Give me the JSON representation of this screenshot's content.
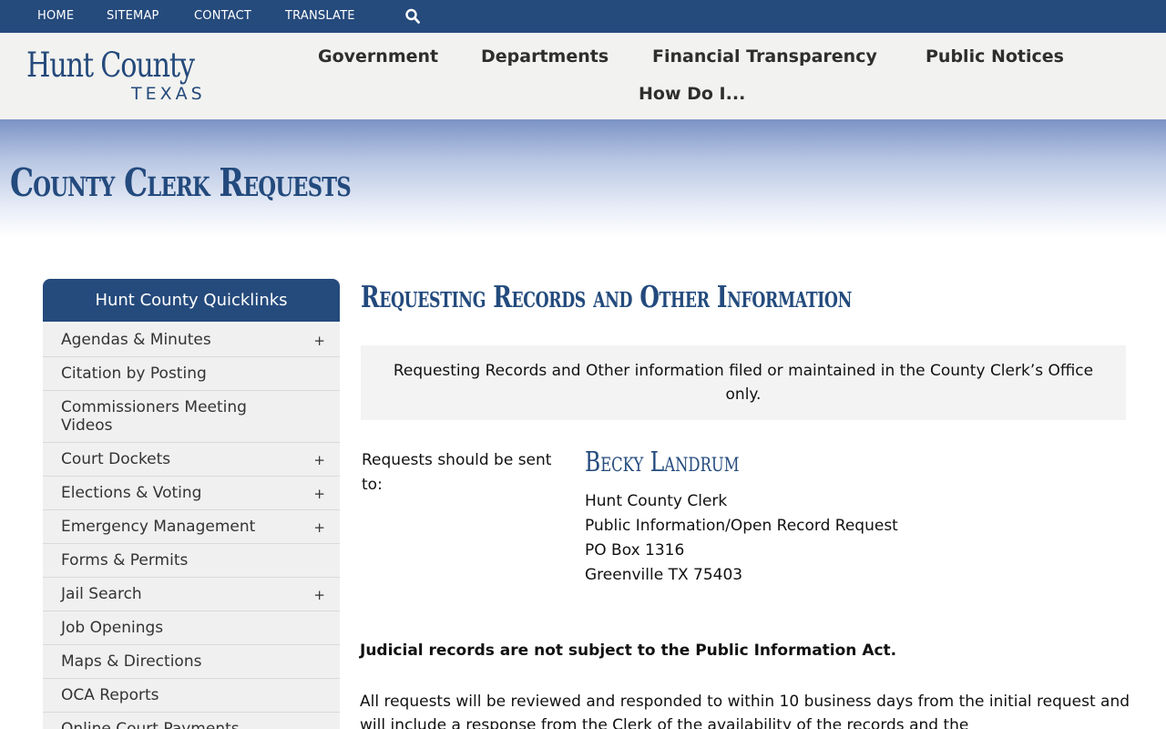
{
  "topbar": {
    "links": [
      "HOME",
      "SITEMAP",
      "CONTACT",
      "TRANSLATE"
    ],
    "search_icon": "search-icon"
  },
  "logo": {
    "line1": "Hunt County",
    "line2": "TEXAS"
  },
  "mainnav": [
    "Government",
    "Departments",
    "Financial Transparency",
    "Public Notices",
    "How Do I..."
  ],
  "banner": {
    "title": "County Clerk Requests"
  },
  "sidebar": {
    "title": "Hunt County Quicklinks",
    "items": [
      {
        "label": "Agendas & Minutes",
        "expand": "+"
      },
      {
        "label": "Citation by Posting",
        "expand": ""
      },
      {
        "label": "Commissioners Meeting Videos",
        "expand": ""
      },
      {
        "label": "Court Dockets",
        "expand": "+"
      },
      {
        "label": "Elections & Voting",
        "expand": "+"
      },
      {
        "label": "Emergency Management",
        "expand": "+"
      },
      {
        "label": "Forms & Permits",
        "expand": ""
      },
      {
        "label": "Jail Search",
        "expand": "+"
      },
      {
        "label": "Job Openings",
        "expand": ""
      },
      {
        "label": "Maps & Directions",
        "expand": ""
      },
      {
        "label": "OCA Reports",
        "expand": ""
      },
      {
        "label": "Online Court Payments",
        "expand": ""
      }
    ]
  },
  "content": {
    "heading": "Requesting Records and Other Information",
    "notice": "Requesting Records and Other information filed or maintained in the County Clerk’s Office only.",
    "requests_label": "Requests should be sent to:",
    "clerk_name": "Becky Landrum",
    "address": [
      "Hunt County Clerk",
      "Public Information/Open Record Request",
      "PO Box 1316",
      "Greenville TX 75403"
    ],
    "judicial": "Judicial records are not subject to the Public Information Act.",
    "body": "All requests will be reviewed and responded to within 10 business days from the initial request and will include a response from the Clerk of the availability of the records and the"
  },
  "colors": {
    "brand_blue": "#254a7c",
    "header_bg": "#f2f2f0"
  }
}
